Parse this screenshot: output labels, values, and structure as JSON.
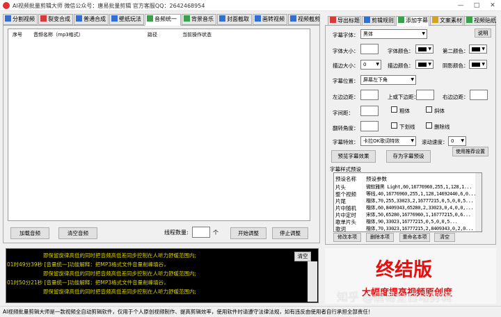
{
  "window": {
    "title": "AI视频批量剪辑大师   微信公众号：唐易批量剪辑   官方客服QQ：2642468954",
    "minimize": "—",
    "maximize": "□",
    "close": "✕"
  },
  "left_tabs": [
    {
      "label": "分割视频",
      "icon": "split-icon",
      "color": "#2f6fd6"
    },
    {
      "label": "裂变合成",
      "icon": "merge-icon",
      "color": "#d83a3a"
    },
    {
      "label": "普通合成",
      "icon": "play-icon",
      "color": "#2f6fd6"
    },
    {
      "label": "壁纸玩法",
      "icon": "wallpaper-icon",
      "color": "#2f6fd6"
    },
    {
      "label": "音频统一",
      "icon": "audio-icon",
      "color": "#3aa04a"
    },
    {
      "label": "背景音乐",
      "icon": "music-icon",
      "color": "#3aa04a"
    },
    {
      "label": "封面截取",
      "icon": "cover-icon",
      "color": "#2f6fd6"
    },
    {
      "label": "画转视频",
      "icon": "image-icon",
      "color": "#2f6fd6"
    },
    {
      "label": "视频截剪",
      "icon": "clip-icon",
      "color": "#2f6fd6"
    }
  ],
  "audio_table": {
    "columns": [
      "序号",
      "音频名称（mp3格式）",
      "路径",
      "当前操作状态"
    ],
    "rows": []
  },
  "audio_controls": {
    "add_label": "加载音频",
    "clear_label": "清空音频",
    "thread_label": "线程数量:",
    "thread_value": "",
    "thread_unit": "个",
    "start_label": "开始调整",
    "stop_label": "停止调整"
  },
  "log": {
    "lines": [
      "即保留旋律高低的同时把音频高低差同步控制在人听力舒缓范围内;",
      "01时49分39秒 [音量统一]功能解释：把MP3格式文件音量削峰填谷，",
      "即保留旋律高低的同时把音频高低差同步控制在人听力舒缓范围内;",
      "01时50分21秒 [音量统一]功能解释：把MP3格式文件音量削峰填谷，",
      "即保留旋律高低的同时把音频高低差同步控制在人听力舒缓范围内;"
    ],
    "clear_label": "清空"
  },
  "right_tabs": [
    {
      "label": "导出标题",
      "icon": "export-icon",
      "color": "#d83a3a"
    },
    {
      "label": "剪辑规则",
      "icon": "rules-icon",
      "color": "#2f6fd6"
    },
    {
      "label": "添加字幕",
      "icon": "subtitle-icon",
      "color": "#3aa04a"
    },
    {
      "label": "文案素材",
      "icon": "copywriting-icon",
      "color": "#d8a020"
    },
    {
      "label": "视频贴纸",
      "icon": "sticker-icon",
      "color": "#3aa04a"
    }
  ],
  "subtitle": {
    "font_label": "字幕字体：",
    "font_value": "黑体",
    "help_label": "说明",
    "size_label": "字体大小：",
    "font_color_label": "字体颜色：",
    "second_color_label": "第二颜色：",
    "border_size_label": "描边大小：",
    "border_size_value": "0",
    "border_color_label": "描边颜色：",
    "shadow_color_label": "阴影颜色：",
    "position_label": "字幕位置：",
    "position_value": "屏幕左下角",
    "lr_margin_label": "左边边距：",
    "tb_margin_label": "上或下边距：",
    "right_margin_label": "右边边距：",
    "spacing_label": "字间距：",
    "bold_label": "粗体",
    "italic_label": "斜体",
    "rotate_label": "翻转角度：",
    "underline_label": "下划线",
    "strike_label": "删除线",
    "effect_label": "字幕特效：",
    "effect_value": "卡拉OK歌词特效",
    "scroll_label": "滚动速度：",
    "scroll_value": "0",
    "preview_label": "预览字幕效果",
    "save_preset_label": "存为字幕预设",
    "recommend_label": "使用推荐设置",
    "swatch_color": "#000000"
  },
  "presets": {
    "title": "字幕样式预设",
    "col_name": "预设名称",
    "col_param": "预设参数",
    "rows": [
      {
        "name": "片头",
        "param": "微软雅黑 Light,60,16776960,255,1,128,1..."
      },
      {
        "name": "整个视频",
        "param": "等线,40,16776960,255,1,128,14692440,6,0..."
      },
      {
        "name": "片尾",
        "param": "楷体,70,255,33023,2,16777215,0,5,0,0,5..."
      },
      {
        "name": "片中随机",
        "param": "楷体,60,8409343,65280,2,33023,0,4,0,0,..."
      },
      {
        "name": "片中定时",
        "param": "宋体,50,65280,16776960,1,16777215,0,6..."
      },
      {
        "name": "歌单片头",
        "param": "楷体,90,33023,16777215,0,5,0,0,5..."
      },
      {
        "name": "歌词",
        "param": "楷体,70,33023,16777215,2,8409343,0,2,0..."
      }
    ],
    "edit_label": "修改本项",
    "delete_label": "删除本项",
    "rename_label": "重命名本项",
    "clear_label": "清空"
  },
  "promo": {
    "main": "终结版",
    "sub": "大幅度提高视频原创度",
    "watermark": "知乎 @唐易全自动剪辑"
  },
  "status": {
    "text": "AI视频批量剪辑大师是一款视频全自动剪辑软件，仅用于个人原创视频制作、提高剪辑效率，使用软件时请遵守法律法规，如有违反由使用者自行承担全部责任！"
  }
}
